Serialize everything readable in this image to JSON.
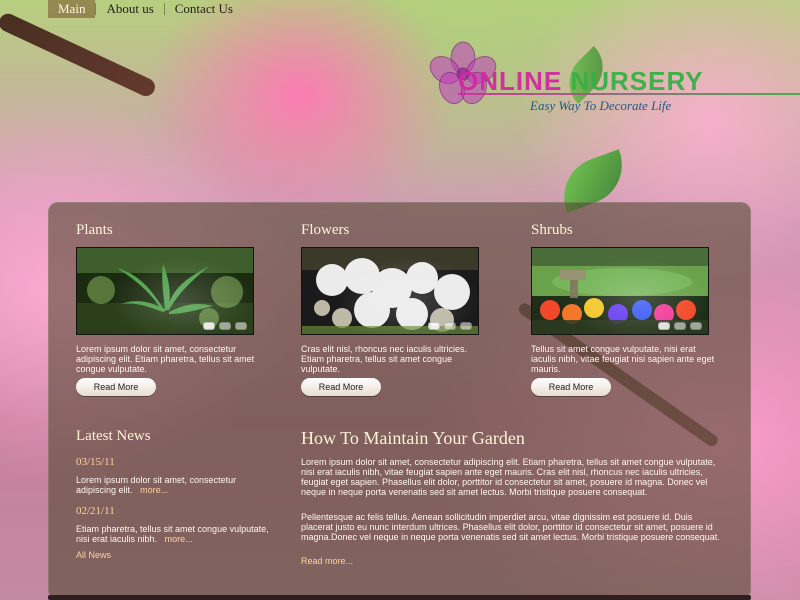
{
  "nav": {
    "items": [
      {
        "label": "Main",
        "active": true
      },
      {
        "label": "About us",
        "active": false
      },
      {
        "label": "Contact Us",
        "active": false
      }
    ]
  },
  "logo": {
    "word1": "ONLINE",
    "word2": "NURSERY",
    "tagline": "Easy Way To Decorate Life"
  },
  "sections": {
    "plants": {
      "title": "Plants",
      "text": "Lorem ipsum dolor sit amet, consectetur adipiscing elit. Etiam pharetra, tellus sit amet congue vulputate.",
      "button": "Read More"
    },
    "flowers": {
      "title": "Flowers",
      "text": "Cras elit nisl, rhoncus nec iaculis ultricies. Etiam pharetra, tellus sit amet congue vulputate.",
      "button": "Read More"
    },
    "shrubs": {
      "title": "Shrubs",
      "text": "Tellus sit amet congue vulputate, nisi erat iaculis nibh, vitae feugiat nisi sapien ante eget mauris.",
      "button": "Read More"
    }
  },
  "latest_news": {
    "title": "Latest News",
    "items": [
      {
        "date": "03/15/11",
        "text": "Lorem ipsum dolor sit amet, consectetur adipiscing elit.",
        "more": "more..."
      },
      {
        "date": "02/21/11",
        "text": "Etiam pharetra, tellus sit amet congue vulputate, nisi erat iaculis nibh.",
        "more": "more..."
      }
    ],
    "all_news": "All News"
  },
  "article": {
    "title": "How To Maintain Your Garden",
    "p1": "Lorem ipsum dolor sit amet, consectetur adipiscing elit. Etiam pharetra, tellus sit amet congue vulputate, nisi erat iaculis nibh, vitae feugiat sapien ante eget mauris. Cras elit nisl, rhoncus nec iaculis ultricies, feugiat eget sapien. Phasellus elit dolor, porttitor id consectetur sit amet, posuere id magna. Donec vel neque in neque porta venenatis sed sit amet lectus. Morbi tristique posuere consequat.",
    "p2": "Pellentesque ac felis tellus. Aenean sollicitudin imperdiet arcu, vitae dignissim est posuere id. Duis placerat justo eu nunc interdum ultrices. Phasellus elit dolor, porttitor id consectetur sit amet, posuere id magna.Donec vel neque in neque porta venenatis sed sit amet lectus. Morbi tristique posuere consequat.",
    "read_more": "Read more..."
  }
}
